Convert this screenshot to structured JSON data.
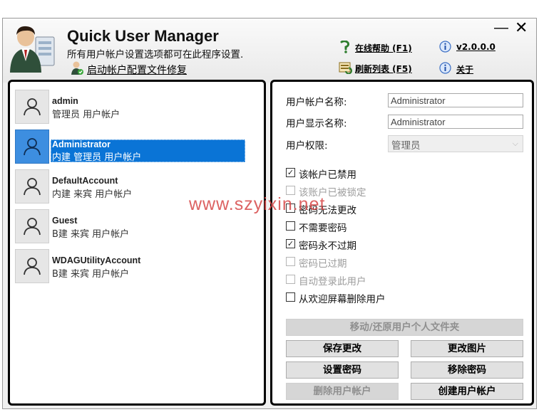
{
  "app": {
    "title": "Quick User Manager",
    "subtitle": "所有用户帐户设置选项都可在此程序设置.",
    "repair_link": "启动帐户配置文件修复",
    "help_link": "在线帮助 (F1)",
    "version_link": "v2.0.0.0",
    "refresh_link": "刷新列表 (F5)",
    "about_link": "关于",
    "minimize_glyph": "—",
    "close_glyph": "✕"
  },
  "users": [
    {
      "name": "admin",
      "desc": "管理员 用户帐户"
    },
    {
      "name": "Administrator",
      "desc": "内建 管理员 用户帐户"
    },
    {
      "name": "DefaultAccount",
      "desc": "内建 来宾 用户帐户"
    },
    {
      "name": "Guest",
      "desc": "B建 来宾 用户帐户"
    },
    {
      "name": "WDAGUtilityAccount",
      "desc": "B建 来宾 用户帐户"
    }
  ],
  "details": {
    "account_name_label": "用户帐户名称:",
    "account_name_value": "Administrator",
    "display_name_label": "用户显示名称:",
    "display_name_value": "Administrator",
    "rights_label": "用户权限:",
    "rights_value": "管理员",
    "checks": [
      {
        "label": "该帐户已禁用",
        "checked": true,
        "disabled": false
      },
      {
        "label": "该账户已被锁定",
        "checked": false,
        "disabled": true
      },
      {
        "label": "密码无法更改",
        "checked": false,
        "disabled": false
      },
      {
        "label": "不需要密码",
        "checked": false,
        "disabled": false
      },
      {
        "label": "密码永不过期",
        "checked": true,
        "disabled": false
      },
      {
        "label": "密码已过期",
        "checked": false,
        "disabled": true
      },
      {
        "label": "自动登录此用户",
        "checked": false,
        "disabled": true
      },
      {
        "label": "从欢迎屏幕删除用户",
        "checked": false,
        "disabled": false
      }
    ],
    "check_mark": "✓",
    "buttons": {
      "move_folder": "移动/还原用户个人文件夹",
      "save": "保存更改",
      "change_picture": "更改图片",
      "set_password": "设置密码",
      "remove_password": "移除密码",
      "delete_user": "删除用户帐户",
      "create_user": "创建用户帐户"
    }
  },
  "watermark": "www.szyixin.net",
  "colors": {
    "selection": "#0a74d6",
    "button_face": "#e1e1e1",
    "disabled_text": "#9d9d9d"
  },
  "icons": [
    "app-user-icon",
    "repair-user-icon",
    "help-icon",
    "info-icon",
    "refresh-icon",
    "user-avatar-icon"
  ]
}
